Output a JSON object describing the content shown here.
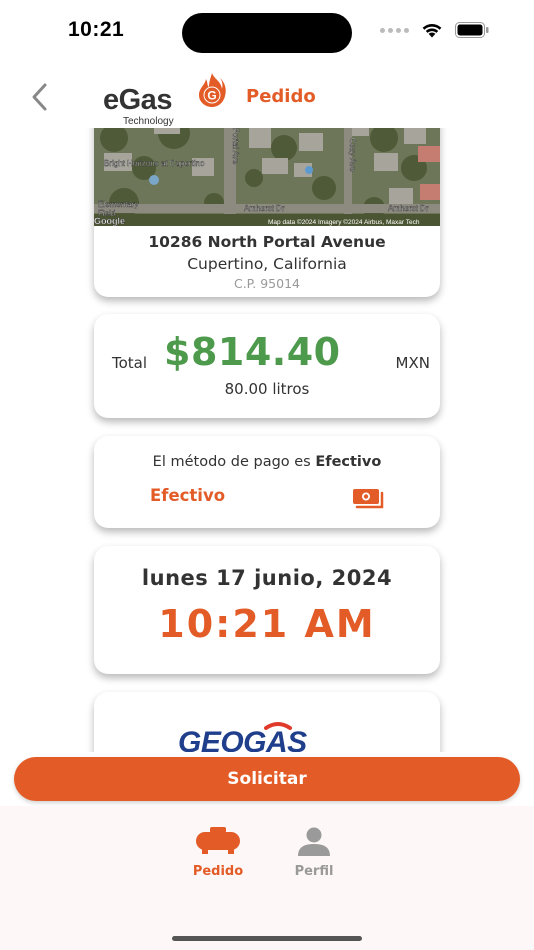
{
  "status_bar": {
    "time": "10:21"
  },
  "header": {
    "logo_text": "eGas",
    "logo_badge": "G",
    "logo_sub": "Technology",
    "title": "Pedido"
  },
  "map": {
    "labels": {
      "place": "Bright Horizons at Cupertino",
      "street1": "Amherst Dr",
      "street2": "Amherst Dr",
      "portal": "Portal Ave",
      "cozy": "Cozy Ave",
      "school": "Elementary",
      "field": "Field",
      "google": "Google",
      "credit": "Map data ©2024 Imagery ©2024 Airbus, Maxar Tech"
    }
  },
  "address": {
    "street": "10286 North Portal Avenue",
    "city": "Cupertino, California",
    "postal": "C.P. 95014"
  },
  "total": {
    "label": "Total",
    "amount": "$814.40",
    "currency": "MXN",
    "liters": "80.00 litros"
  },
  "payment": {
    "prefix": "El método de pago es",
    "method_bold": "Efectivo",
    "method_label": "Efectivo",
    "icon": "cash-icon"
  },
  "schedule": {
    "date": "lunes 17 junio, 2024",
    "time": "10:21 AM"
  },
  "provider": {
    "name": "GEOGAS"
  },
  "action": {
    "submit_label": "Solicitar"
  },
  "tabs": [
    {
      "label": "Pedido",
      "icon": "gas-tank-icon",
      "active": true
    },
    {
      "label": "Perfil",
      "icon": "person-icon",
      "active": false
    }
  ],
  "colors": {
    "accent": "#e35b26",
    "amount": "#4e9a4c",
    "text": "#333333",
    "muted": "#999999"
  }
}
